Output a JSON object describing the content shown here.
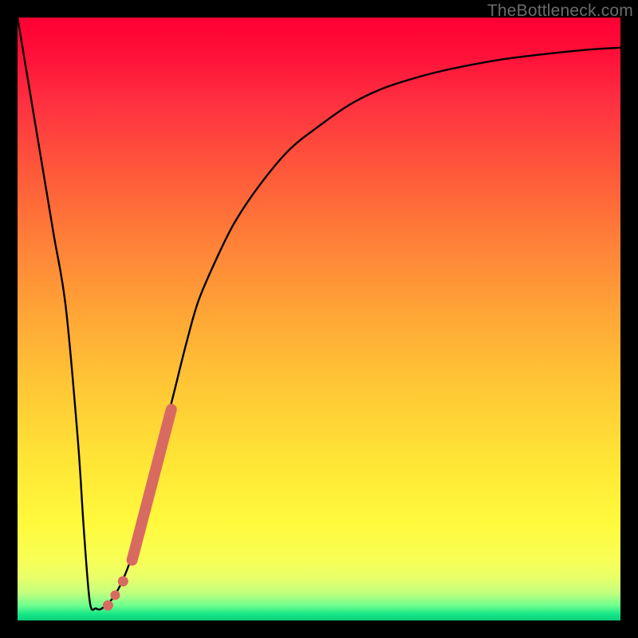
{
  "watermark": "TheBottleneck.com",
  "colors": {
    "curve": "#000000",
    "marker": "#d96a62",
    "frame": "#000000"
  },
  "chart_data": {
    "type": "line",
    "title": "",
    "xlabel": "",
    "ylabel": "",
    "xlim": [
      0,
      100
    ],
    "ylim": [
      0,
      100
    ],
    "grid": false,
    "legend": false,
    "series": [
      {
        "name": "bottleneck-curve",
        "x": [
          0,
          2,
          4,
          6,
          8,
          10,
          11,
          12,
          13,
          14,
          16,
          18,
          20,
          22,
          24,
          26,
          28,
          30,
          33,
          36,
          40,
          45,
          50,
          55,
          60,
          66,
          72,
          80,
          88,
          95,
          100
        ],
        "y": [
          100,
          88,
          76,
          64,
          52,
          30,
          15,
          3,
          2,
          2,
          4,
          8,
          14,
          22,
          30,
          38,
          46,
          53,
          60,
          66,
          72,
          78,
          82,
          85.5,
          88,
          90,
          91.5,
          93,
          94,
          94.7,
          95
        ]
      }
    ],
    "markers": [
      {
        "name": "marker-segment",
        "x_start": 19.0,
        "y_start": 10,
        "x_end": 25.5,
        "y_end": 35
      },
      {
        "name": "marker-dot-1",
        "x": 17.5,
        "y": 6.5
      },
      {
        "name": "marker-dot-2",
        "x": 16.2,
        "y": 4.2
      },
      {
        "name": "marker-dot-3",
        "x": 15.0,
        "y": 2.5
      }
    ]
  }
}
